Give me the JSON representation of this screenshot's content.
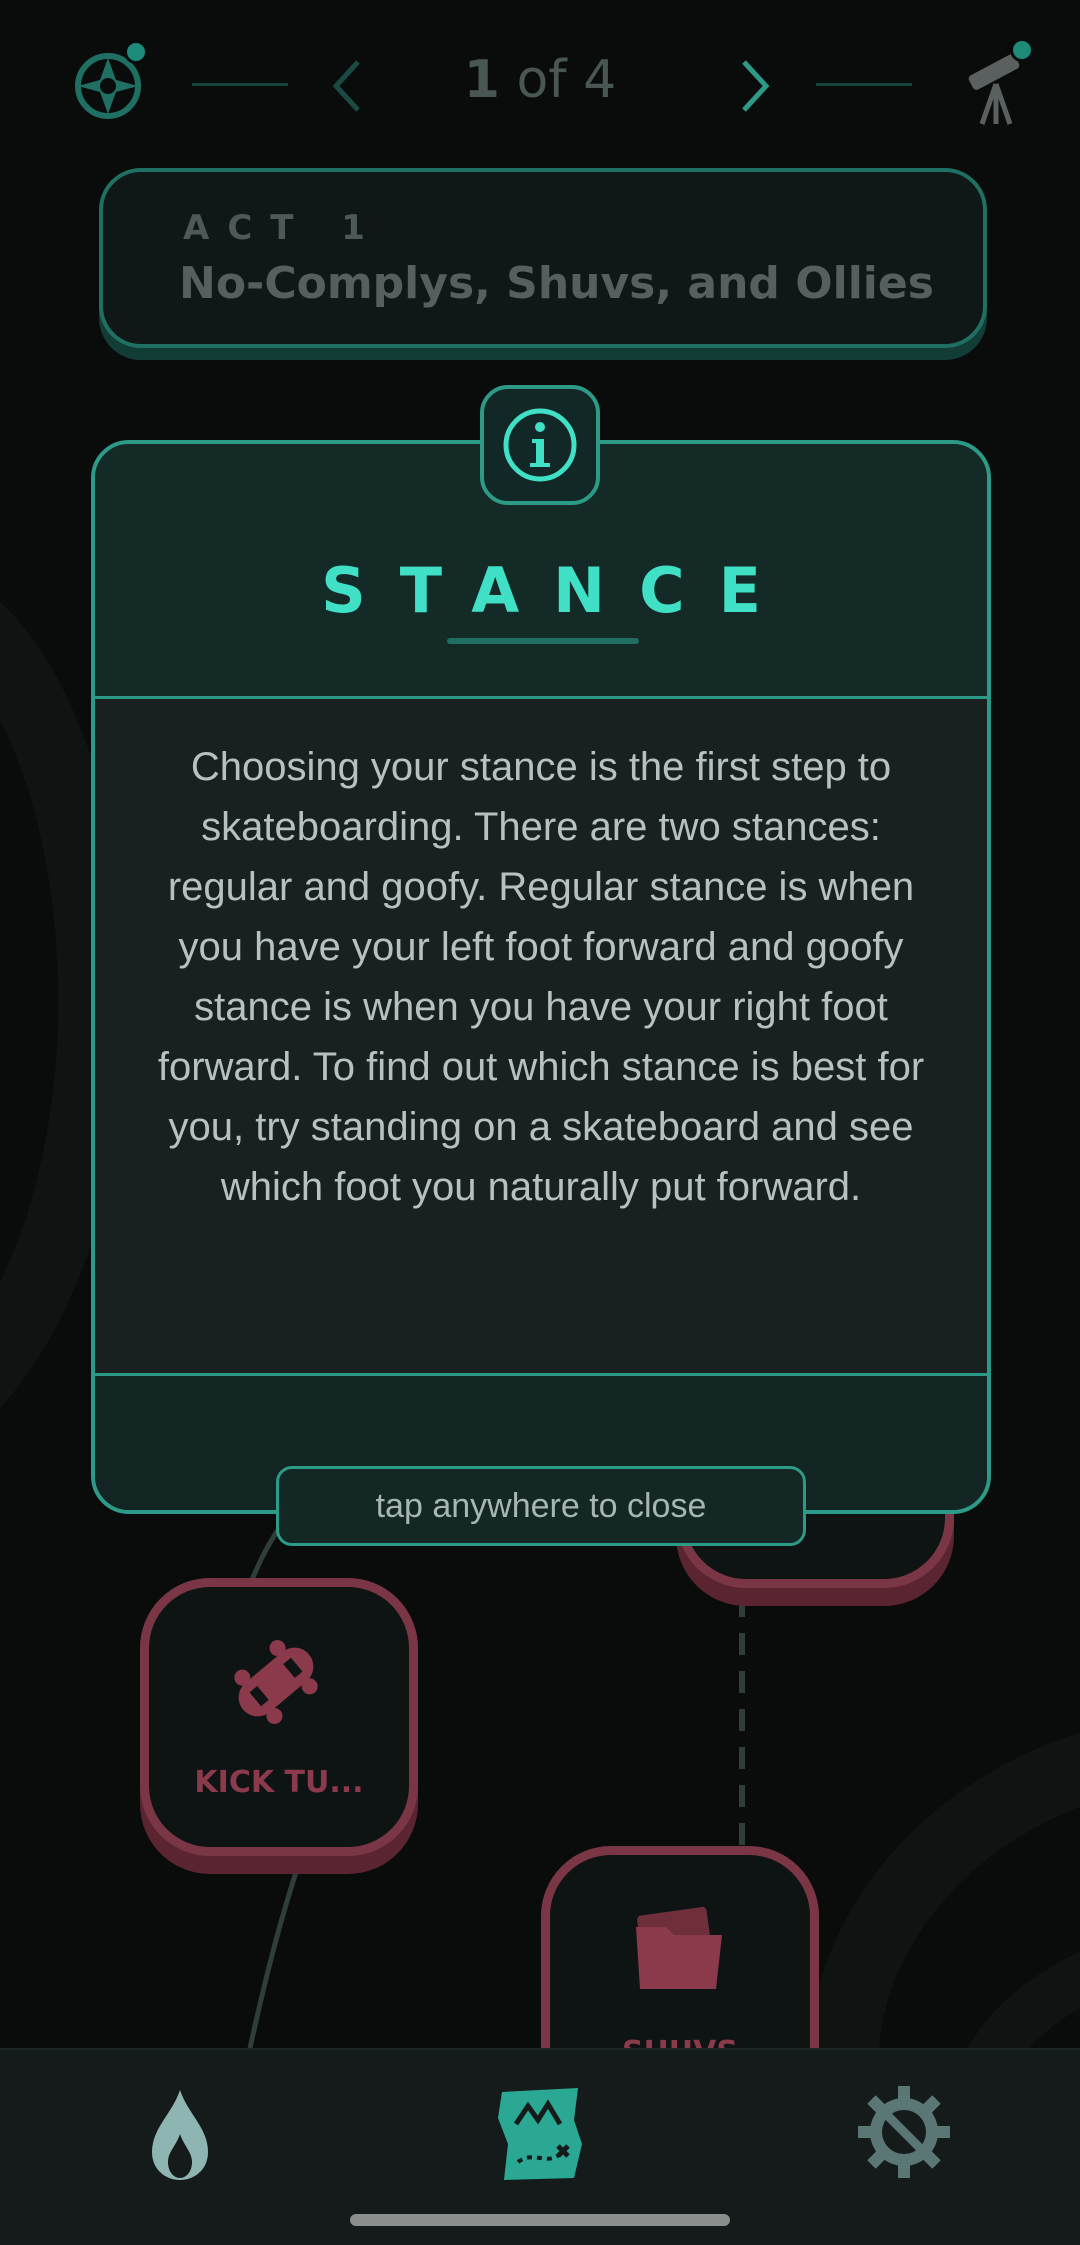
{
  "nav": {
    "page_current": "1",
    "page_of": "of",
    "page_total": "4",
    "left_icon": "compass-icon",
    "right_icon": "telescope-icon"
  },
  "act": {
    "label": "ACT 1",
    "title": "No-Complys, Shuvs, and Ollies"
  },
  "modal": {
    "icon": "info-icon",
    "title": "STANCE",
    "body": "Choosing your stance is the first step to skateboarding. There are two stances: regular and goofy. Regular stance is when you have your left foot forward and goofy stance is when you have your right foot forward. To find out which stance is best for you, try standing on a skateboard and see which foot you naturally put forward.",
    "close_hint": "tap anywhere to close"
  },
  "map": {
    "nodes": [
      {
        "label": "KICK TU...",
        "icon": "skateboard-icon"
      },
      {
        "label": "SHUVS",
        "icon": "folder-icon"
      }
    ]
  },
  "bottom_nav": {
    "items": [
      {
        "icon": "flame-icon"
      },
      {
        "icon": "map-icon"
      },
      {
        "icon": "settings-icon"
      }
    ]
  },
  "colors": {
    "background": "#0a0c0c",
    "accent": "#2c9a86",
    "title": "#3fe0c6",
    "node": "#7a3644"
  }
}
